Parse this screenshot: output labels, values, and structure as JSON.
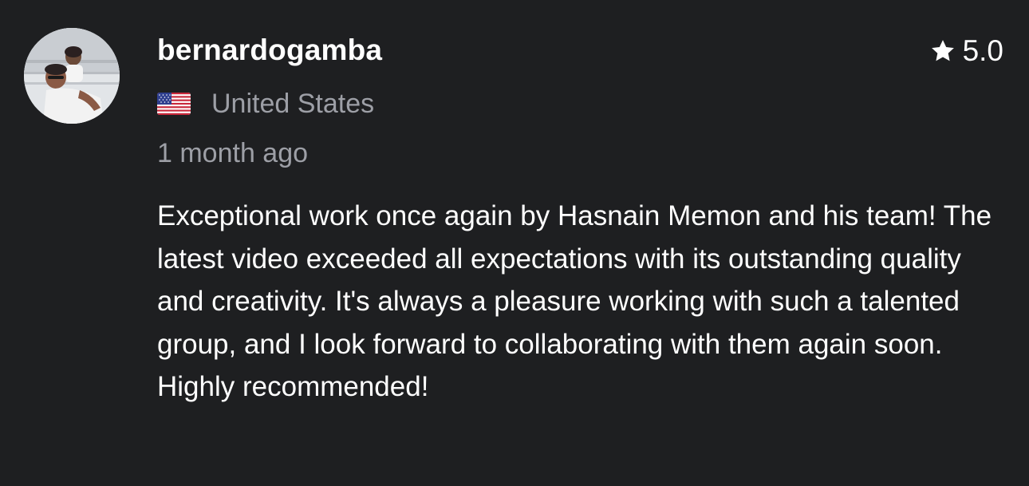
{
  "review": {
    "username": "bernardogamba",
    "rating": "5.0",
    "country": "United States",
    "time_ago": "1 month ago",
    "text": "Exceptional work once again by Hasnain Memon and his team! The latest video exceeded all expectations with its outstanding quality and creativity. It's always a pleasure working with such a talented group, and I look forward to collaborating with them again soon. Highly recommended!"
  },
  "icons": {
    "rating": "star-icon",
    "country": "us-flag-icon"
  },
  "colors": {
    "background": "#1e1f21",
    "text_primary": "#ffffff",
    "text_muted": "#9d9fa6"
  }
}
